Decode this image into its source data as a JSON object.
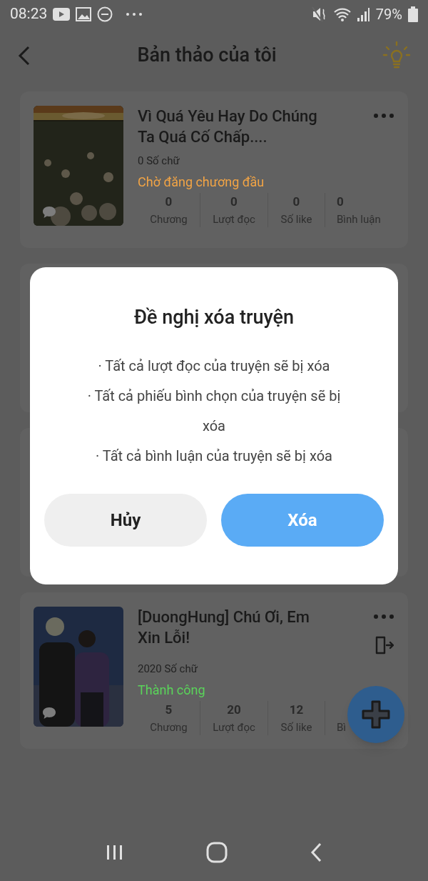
{
  "status_bar": {
    "time": "08:23",
    "battery": "79%"
  },
  "header": {
    "title": "Bản thảo của tôi"
  },
  "drafts": [
    {
      "kind": "story",
      "title": "Vì Quá Yêu Hay Do Chúng Ta Quá Cố Chấp....",
      "word_count": "0 Số chữ",
      "status": "Chờ đăng chương đầu",
      "color": "#f2a445",
      "has_export": false,
      "stats": [
        {
          "value": "0",
          "label": "Chương"
        },
        {
          "value": "0",
          "label": "Lượt đọc"
        },
        {
          "value": "0",
          "label": "Số like"
        },
        {
          "value": "0",
          "label": "Bình luận"
        }
      ]
    },
    {
      "kind": "covered"
    },
    {
      "kind": "covered"
    },
    {
      "kind": "story",
      "title": "[DuongHung] Chú Ơi, Em Xin Lỗi!",
      "word_count": "2020 Số chữ",
      "status": "Thành công",
      "color": "#5ad45a",
      "has_export": true,
      "stats": [
        {
          "value": "5",
          "label": "Chương"
        },
        {
          "value": "20",
          "label": "Lượt đọc"
        },
        {
          "value": "12",
          "label": "Số like"
        },
        {
          "label": "Bì"
        }
      ]
    }
  ],
  "dialog": {
    "title": "Đề nghị xóa truyện",
    "lines": [
      "· Tất cả lượt đọc của truyện sẽ bị xóa",
      "· Tất cả phiếu bình chọn của truyện sẽ bị xóa",
      "· Tất cả bình luận của truyện sẽ bị xóa"
    ],
    "buttons": [
      {
        "label": "Hủy",
        "kind": "secondary"
      },
      {
        "label": "Xóa",
        "kind": "primary"
      }
    ]
  }
}
